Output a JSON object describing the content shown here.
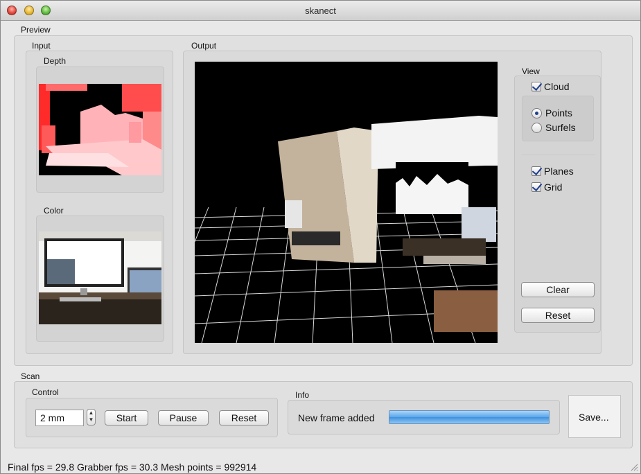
{
  "window": {
    "title": "skanect"
  },
  "preview": {
    "label": "Preview",
    "input": {
      "label": "Input",
      "depth_label": "Depth",
      "color_label": "Color"
    },
    "output": {
      "label": "Output"
    },
    "view": {
      "label": "View",
      "cloud_label": "Cloud",
      "cloud_checked": true,
      "points_label": "Points",
      "points_selected": true,
      "surfels_label": "Surfels",
      "surfels_selected": false,
      "planes_label": "Planes",
      "planes_checked": true,
      "grid_label": "Grid",
      "grid_checked": true,
      "clear_label": "Clear",
      "reset_label": "Reset"
    }
  },
  "scan": {
    "label": "Scan",
    "control": {
      "label": "Control",
      "resolution_value": "2 mm",
      "start_label": "Start",
      "pause_label": "Pause",
      "reset_label": "Reset"
    },
    "info": {
      "label": "Info",
      "status_text": "New frame added",
      "progress": 1.0
    },
    "save_label": "Save..."
  },
  "statusbar": {
    "text": "Final fps = 29.8 Grabber fps = 30.3   Mesh points = 992914"
  },
  "colors": {
    "progress_blue": "#5aa6ea",
    "check_blue": "#1e3f8f",
    "depth_red": "#ff3b3b",
    "depth_pink": "#ffb3b8"
  }
}
